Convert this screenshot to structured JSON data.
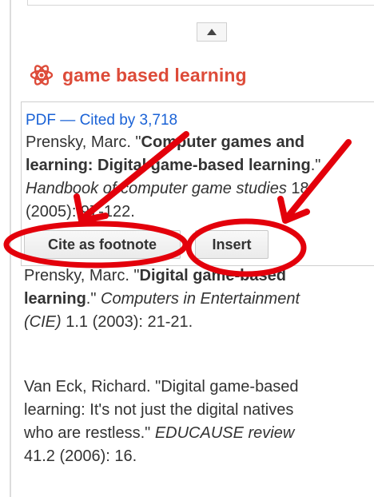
{
  "header": {
    "title": "game based learning",
    "icon": "atom-icon",
    "accent": "#dd4b39"
  },
  "card": {
    "pdf_label": "PDF",
    "separator": "—",
    "cited_by": "Cited by 3,718",
    "citation": {
      "author": "Prensky, Marc. \"",
      "title_line1": "Computer games and",
      "title_line2": "learning: Digital game-based learning",
      "after_title": ".\"",
      "journal": "Handbook of computer game studies",
      "volume": " 18",
      "details": "(2005): 97-122."
    },
    "buttons": {
      "cite_footnote": "Cite as footnote",
      "insert": "Insert"
    }
  },
  "results": [
    {
      "author": "Prensky, Marc. \"",
      "title_line1": "Digital game-based",
      "title_line2": "learning",
      "after_title": ".\" ",
      "journal_line2": "Computers in Entertainment",
      "journal_line3": "(CIE)",
      "details": " 1.1 (2003): 21-21."
    },
    {
      "line1": "Van Eck, Richard. \"Digital game-based",
      "line2": "learning: It's not just the digital natives",
      "line3": "who are restless.\" ",
      "journal": "EDUCAUSE review",
      "line4": "41.2 (2006): 16."
    }
  ],
  "colors": {
    "link": "#1a62d6",
    "annotation": "#e3000b"
  }
}
